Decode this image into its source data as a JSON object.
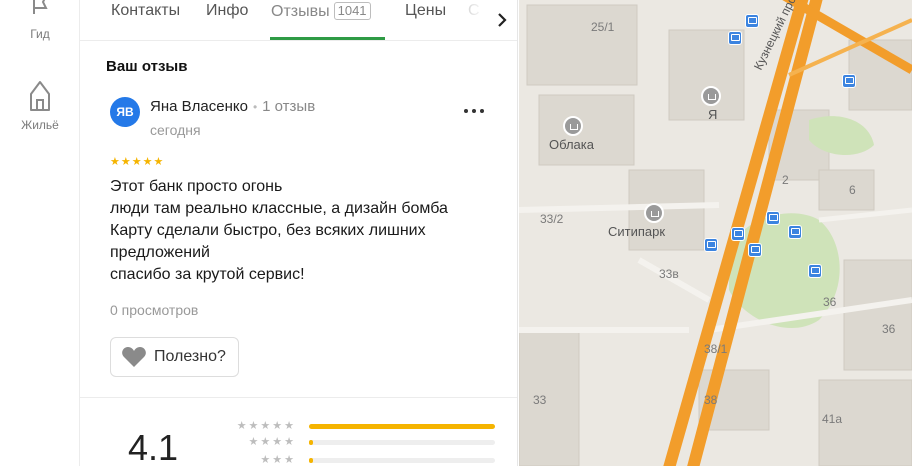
{
  "rail": {
    "guide_label": "Гид",
    "housing_label": "Жильё"
  },
  "tabs": {
    "contacts": "Контакты",
    "info": "Инфо",
    "reviews": "Отзывы",
    "reviews_count": "1041",
    "prices": "Цены",
    "cut": "С"
  },
  "review": {
    "section_title": "Ваш отзыв",
    "avatar_initials": "ЯВ",
    "author_name": "Яна Власенко",
    "author_reviews": "1 отзыв",
    "date": "сегодня",
    "stars": "★★★★★",
    "rating": 5,
    "lines": [
      "Этот банк просто огонь",
      "люди там реально классные, а дизайн бомба",
      "Карту сделали быстро, без всяких лишних предложений",
      "спасибо за крутой сервис!"
    ],
    "views": "0 просмотров",
    "helpful_label": "Полезно?"
  },
  "rating_summary": {
    "value": "4.1",
    "rows": [
      {
        "stars": "★★★★★",
        "fraction": 1.0
      },
      {
        "stars": "★★★★",
        "fraction": 0.02
      },
      {
        "stars": "★★★",
        "fraction": 0.02
      }
    ]
  },
  "map": {
    "places": [
      "Облака",
      "Ситипарк",
      "Я"
    ],
    "street": "Кузнецкий просп",
    "house_numbers": [
      "25/1",
      "33/2",
      "33в",
      "38/1",
      "33",
      "38",
      "41а",
      "36",
      "36",
      "2",
      "6"
    ],
    "colors": {
      "road": "#f29d2b",
      "park": "#cfe3b9",
      "bus": "#3c84e0",
      "building": "#dcd8d0"
    }
  }
}
